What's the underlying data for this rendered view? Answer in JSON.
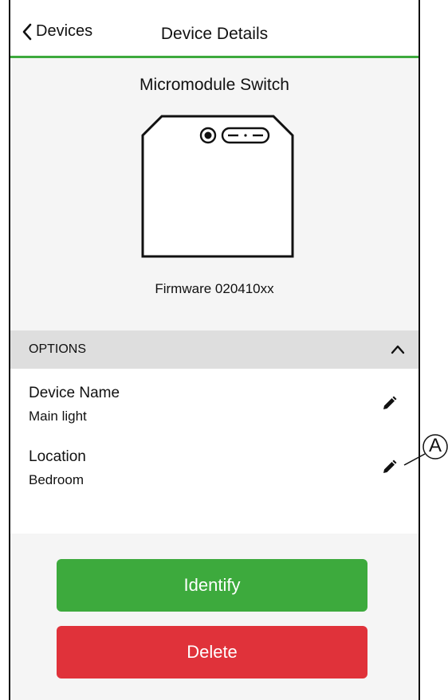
{
  "header": {
    "back_label": "Devices",
    "title": "Device Details",
    "accent_color": "#3daa3d"
  },
  "device": {
    "name": "Micromodule Switch",
    "firmware": "Firmware 020410xx",
    "image_icon": "micromodule-device-icon"
  },
  "options": {
    "section_label": "OPTIONS",
    "expanded": true,
    "fields": [
      {
        "label": "Device Name",
        "value": "Main light",
        "action_icon": "pencil-icon"
      },
      {
        "label": "Location",
        "value": "Bedroom",
        "action_icon": "pencil-icon"
      }
    ]
  },
  "buttons": {
    "identify_label": "Identify",
    "identify_color": "#3daa3d",
    "delete_label": "Delete",
    "delete_color": "#e0323a"
  },
  "annotation": {
    "callout_letter": "A"
  }
}
